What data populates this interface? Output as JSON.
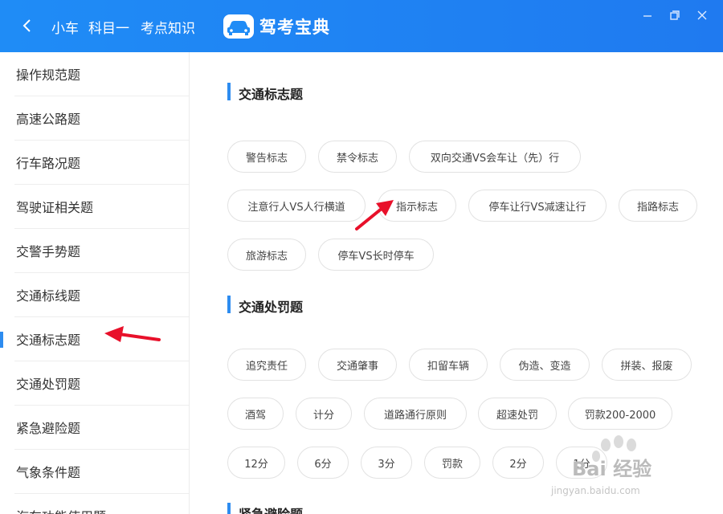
{
  "header": {
    "breadcrumb": [
      "小车",
      "科目一",
      "考点知识"
    ],
    "logo_text": "驾考宝典",
    "accent": "#1f8cf6"
  },
  "sidebar": {
    "active_index": 6,
    "items": [
      {
        "label": "操作规范题"
      },
      {
        "label": "高速公路题"
      },
      {
        "label": "行车路况题"
      },
      {
        "label": "驾驶证相关题"
      },
      {
        "label": "交警手势题"
      },
      {
        "label": "交通标线题"
      },
      {
        "label": "交通标志题"
      },
      {
        "label": "交通处罚题"
      },
      {
        "label": "紧急避险题"
      },
      {
        "label": "气象条件题"
      },
      {
        "label": "汽车功能使用题"
      }
    ]
  },
  "sections": [
    {
      "title": "交通标志题",
      "tags": [
        "警告标志",
        "禁令标志",
        "双向交通VS会车让（先）行",
        "注意行人VS人行横道",
        "指示标志",
        "停车让行VS减速让行",
        "指路标志",
        "旅游标志",
        "停车VS长时停车"
      ]
    },
    {
      "title": "交通处罚题",
      "tags": [
        "追究责任",
        "交通肇事",
        "扣留车辆",
        "伪造、变造",
        "拼装、报废",
        "酒驾",
        "计分",
        "道路通行原则",
        "超速处罚",
        "罚款200-2000",
        "12分",
        "6分",
        "3分",
        "罚款",
        "2分",
        "1分"
      ]
    },
    {
      "title": "紧急避险题"
    }
  ],
  "watermark": {
    "text": "Bai 经验",
    "url": "jingyan.baidu.com"
  },
  "colors": {
    "accent_bar": "#2d8cf0",
    "arrow": "#e8102a"
  }
}
